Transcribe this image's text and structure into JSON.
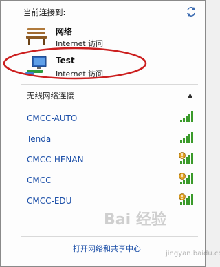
{
  "header": {
    "title": "当前连接到:"
  },
  "connections": [
    {
      "name": "网络",
      "status": "Internet 访问",
      "icon": "bench-network-icon"
    },
    {
      "name": "Test",
      "status": "Internet 访问",
      "icon": "network-computer-icon"
    }
  ],
  "wireless": {
    "section_label": "无线网络连接",
    "networks": [
      {
        "ssid": "CMCC-AUTO",
        "secured": false
      },
      {
        "ssid": "Tenda",
        "secured": false
      },
      {
        "ssid": "CMCC-HENAN",
        "secured": true
      },
      {
        "ssid": "CMCC",
        "secured": true
      },
      {
        "ssid": "CMCC-EDU",
        "secured": true
      }
    ]
  },
  "footer": {
    "link": "打开网络和共享中心"
  },
  "watermark": {
    "main": "Bai 经验",
    "sub": "jingyan.baidu.com"
  },
  "colors": {
    "link": "#1c4fa8",
    "annotation": "#cc1f1f",
    "signal": "#3a9a2a"
  }
}
